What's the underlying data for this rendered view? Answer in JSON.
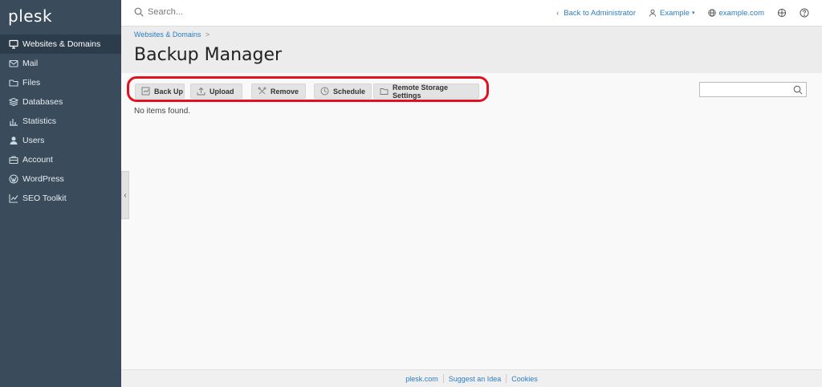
{
  "app": {
    "logo": "plesk"
  },
  "sidebar": {
    "items": [
      {
        "label": "Websites & Domains",
        "icon": "monitor-icon",
        "active": true
      },
      {
        "label": "Mail",
        "icon": "mail-icon"
      },
      {
        "label": "Files",
        "icon": "folder-icon"
      },
      {
        "label": "Databases",
        "icon": "database-icon"
      },
      {
        "label": "Statistics",
        "icon": "bar-chart-icon"
      },
      {
        "label": "Users",
        "icon": "user-icon"
      },
      {
        "label": "Account",
        "icon": "account-icon"
      },
      {
        "label": "WordPress",
        "icon": "wordpress-icon"
      },
      {
        "label": "SEO Toolkit",
        "icon": "seo-chart-icon"
      }
    ]
  },
  "topbar": {
    "search_placeholder": "Search...",
    "back_link": "Back to Administrator",
    "user": "Example",
    "domain": "example.com"
  },
  "page": {
    "breadcrumb": "Websites & Domains",
    "breadcrumb_sep": ">",
    "title": "Backup Manager",
    "empty_text": "No items found."
  },
  "toolbar": {
    "back_up": "Back Up",
    "upload": "Upload",
    "remove": "Remove",
    "schedule": "Schedule",
    "remote_storage": "Remote Storage Settings"
  },
  "footer": {
    "links": [
      "plesk.com",
      "Suggest an Idea",
      "Cookies"
    ]
  },
  "colors": {
    "sidebar_bg": "#3a4b5c",
    "link": "#2c7dbf",
    "highlight": "#e3101f"
  }
}
